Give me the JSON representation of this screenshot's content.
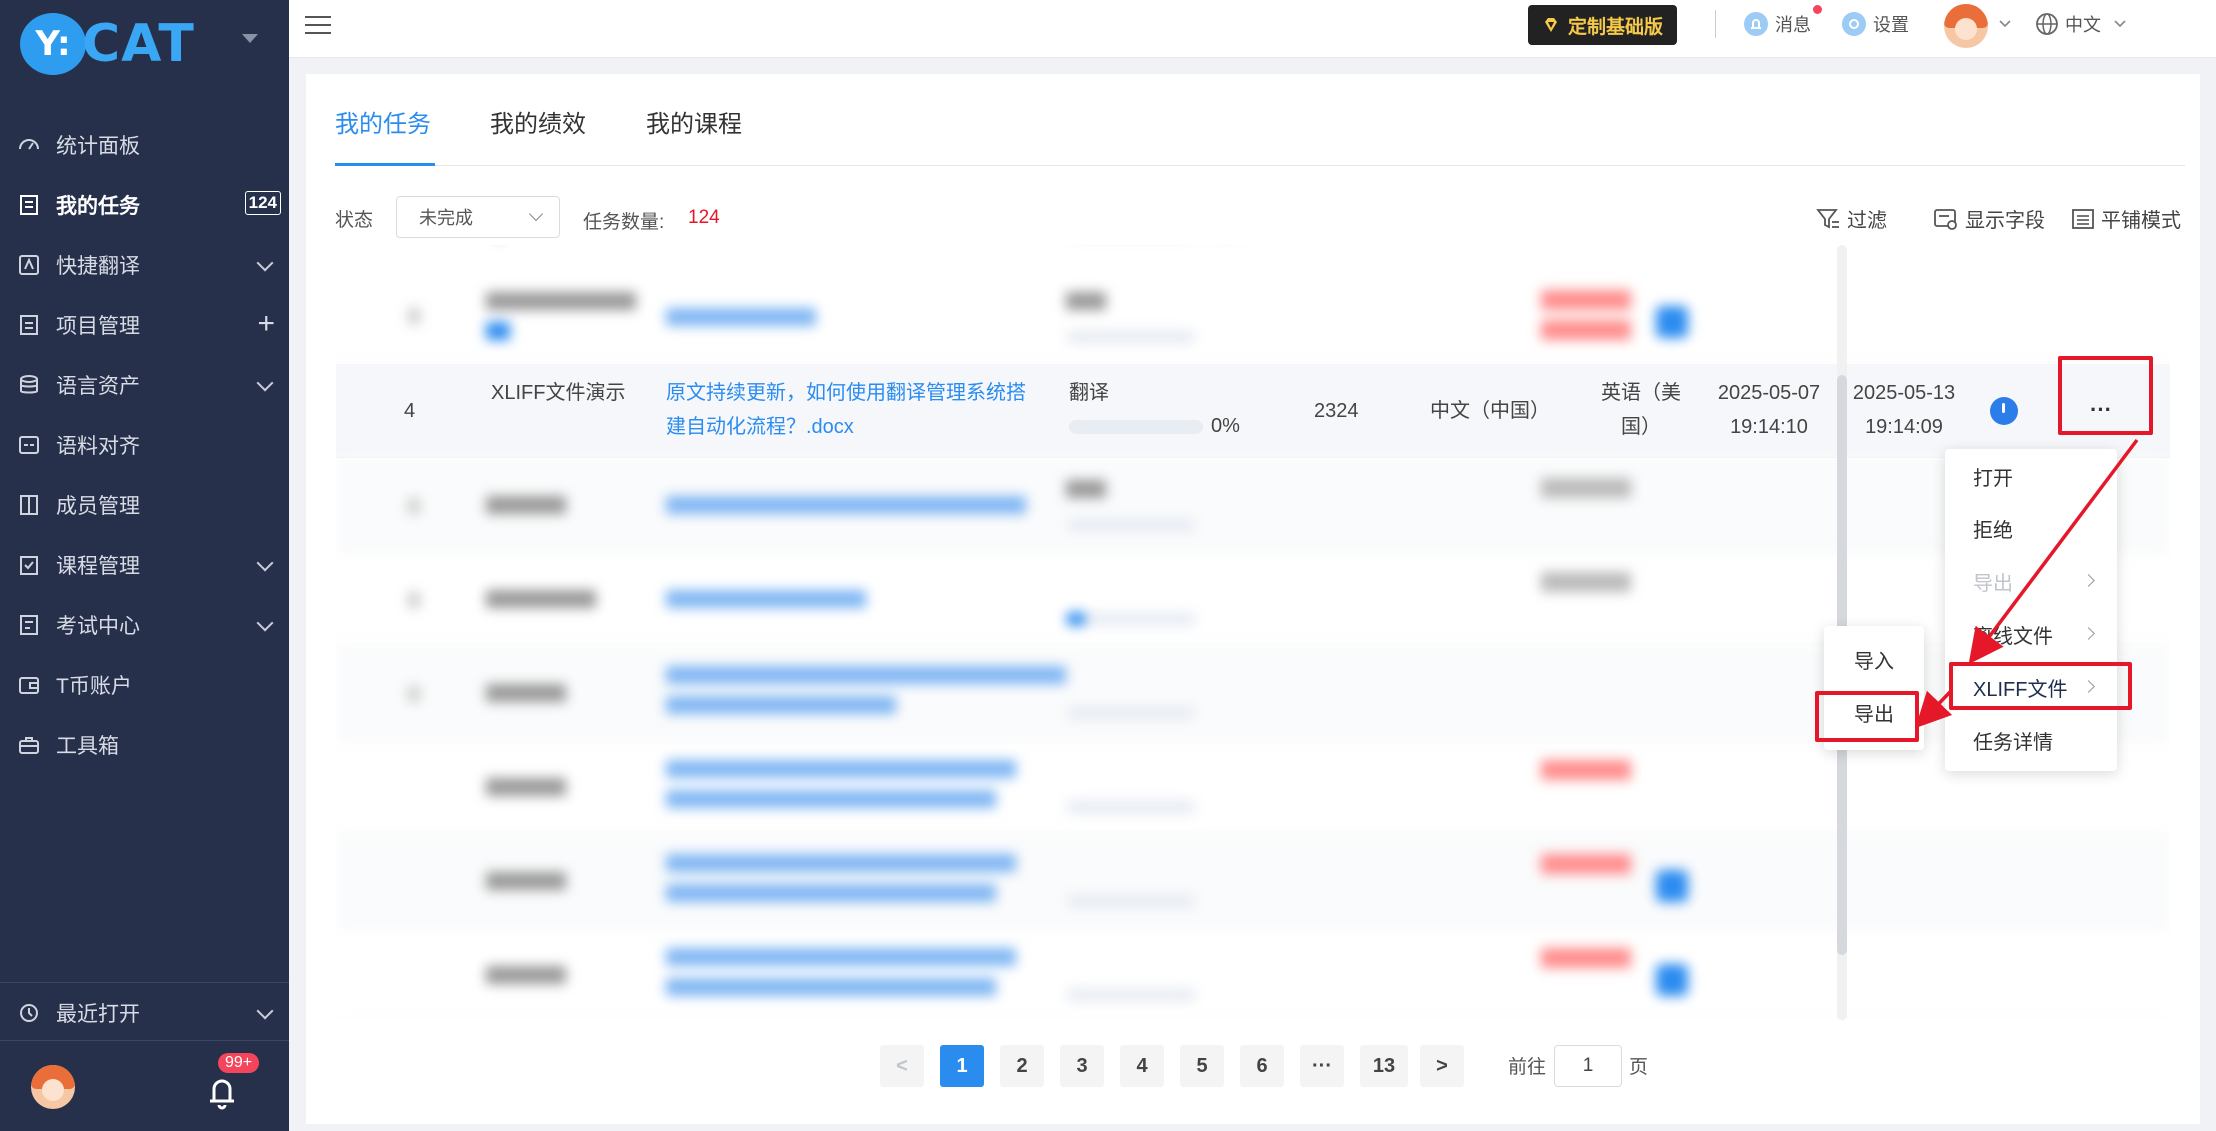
{
  "brand": {
    "logo_badge": "Y:",
    "logo_text": "CAT"
  },
  "sidebar": {
    "items": [
      {
        "label": "统计面板",
        "icon": "dashboard-icon"
      },
      {
        "label": "我的任务",
        "icon": "task-icon",
        "badge": "124",
        "active": true
      },
      {
        "label": "快捷翻译",
        "icon": "translate-icon",
        "expandable": true
      },
      {
        "label": "项目管理",
        "icon": "project-icon",
        "addable": true
      },
      {
        "label": "语言资产",
        "icon": "database-icon",
        "expandable": true
      },
      {
        "label": "语料对齐",
        "icon": "align-icon"
      },
      {
        "label": "成员管理",
        "icon": "members-icon"
      },
      {
        "label": "课程管理",
        "icon": "course-icon",
        "expandable": true
      },
      {
        "label": "考试中心",
        "icon": "exam-icon",
        "expandable": true
      },
      {
        "label": "T币账户",
        "icon": "wallet-icon"
      },
      {
        "label": "工具箱",
        "icon": "toolbox-icon"
      }
    ],
    "recent": "最近打开",
    "notify_badge": "99+"
  },
  "topbar": {
    "vip": "定制基础版",
    "messages": "消息",
    "settings": "设置",
    "language": "中文"
  },
  "tabs": [
    "我的任务",
    "我的绩效",
    "我的课程"
  ],
  "filters": {
    "status_label": "状态",
    "status_value": "未完成",
    "count_label": "任务数量:",
    "count_value": "124",
    "filter": "过滤",
    "show_fields": "显示字段",
    "tile_mode": "平铺模式"
  },
  "task_row": {
    "index": "4",
    "name": "XLIFF文件演示",
    "file_line1": "原文持续更新，如何使用翻译管理系统搭",
    "file_line2": "建自动化流程？.docx",
    "type": "翻译",
    "progress": "0%",
    "progress_value": 0,
    "words": "2324",
    "source": "中文（中国）",
    "target_line1": "英语（美",
    "target_line2": "国）",
    "start_date": "2025-05-07",
    "start_time": "19:14:10",
    "due_date": "2025-05-13",
    "due_time": "19:14:09",
    "more": "···"
  },
  "context_menu": {
    "items": [
      "打开",
      "拒绝",
      "导出",
      "离线文件",
      "XLIFF文件",
      "任务详情"
    ]
  },
  "submenu": {
    "items": [
      "导入",
      "导出"
    ]
  },
  "pagination": {
    "prev": "<",
    "pages": [
      "1",
      "2",
      "3",
      "4",
      "5",
      "6",
      "···",
      "13"
    ],
    "next": ">",
    "goto_label": "前往",
    "goto_value": "1",
    "page_unit": "页"
  },
  "colors": {
    "accent": "#2b8cf0",
    "sidebar": "#27304a",
    "highlight": "#e5182a",
    "count": "#e5182a"
  }
}
